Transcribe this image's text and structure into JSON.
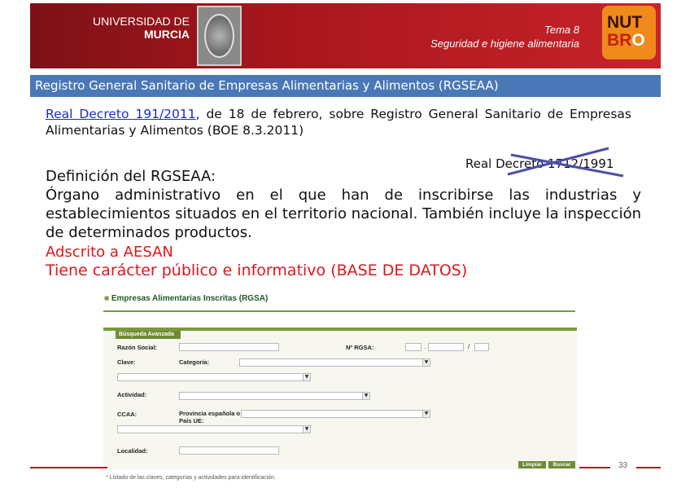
{
  "header": {
    "university_line1": "UNIVERSIDAD DE",
    "university_line2": "MURCIA",
    "tema": "Tema 8",
    "subject": "Seguridad e higiene alimentaria",
    "logo_line1": "NUT",
    "logo_line2a": "BR",
    "logo_line2b": "O",
    "colors": {
      "banner": "#a8161c",
      "logo": "#f08a1a",
      "title_bar": "#4a78b6",
      "accent_red": "#e0161b",
      "link": "#1b2fbf"
    }
  },
  "title_bar": "Registro General Sanitario de Empresas Alimentarias y Alimentos (RGSEAA)",
  "content": {
    "decree_link": "Real Decreto 191/2011",
    "decree_rest": ", de 18 de febrero, sobre Registro General Sanitario de Empresas Alimentarias y Alimentos (BOE 8.3.2011)",
    "crossed_out": "Real Decreto 1712/1991",
    "definition_title": "Definición del RGSEAA:",
    "definition_body": "Órgano administrativo en el que han de inscribirse las industrias y establecimientos situados en el territorio nacional. También incluye la inspección de determinados productos.",
    "adscrito": "Adscrito a AESAN",
    "caracter": "Tiene carácter público e informativo (BASE DE DATOS)"
  },
  "embedded": {
    "title": "Empresas Alimentarias Inscritas (RGSA)",
    "tab": "Búsqueda Avanzada",
    "labels": {
      "razon": "Razón Social:",
      "nrgsa": "Nº RGSA:",
      "clave": "Clave:",
      "categoria": "Categoría:",
      "actividad": "Actividad:",
      "ccaa": "CCAA:",
      "provincia": "Provincia española o País UE:",
      "localidad": "Localidad:"
    },
    "sep_dot": ".",
    "sep_slash": "/",
    "buttons": {
      "limpiar": "Limpiar",
      "buscar": "Buscar"
    },
    "footnote": "* Listado de las claves, categorías y actividades para identificación."
  },
  "footer": {
    "page_number": "33"
  }
}
